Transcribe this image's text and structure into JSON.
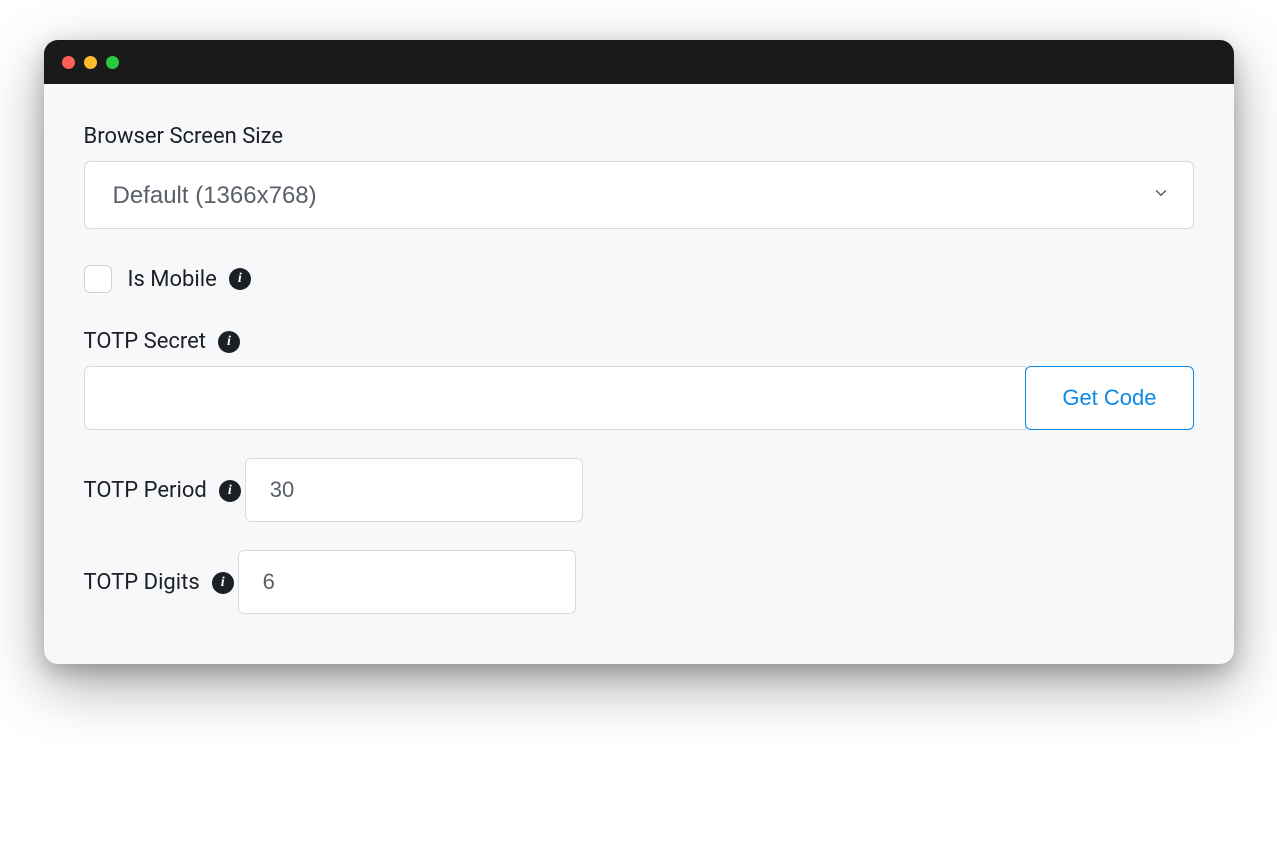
{
  "form": {
    "browser_screen_size": {
      "label": "Browser Screen Size",
      "selected": "Default (1366x768)"
    },
    "is_mobile": {
      "label": "Is Mobile",
      "checked": false
    },
    "totp_secret": {
      "label": "TOTP Secret",
      "value": "",
      "button_label": "Get Code"
    },
    "totp_period": {
      "label": "TOTP Period",
      "value": "30"
    },
    "totp_digits": {
      "label": "TOTP Digits",
      "value": "6"
    }
  }
}
